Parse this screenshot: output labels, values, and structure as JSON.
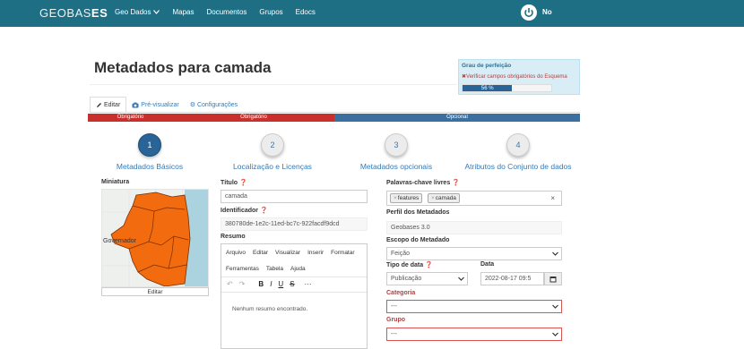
{
  "nav": {
    "brand_light": "GEOBAS",
    "brand_bold": "ES",
    "items": [
      "Geo Dados",
      "Mapas",
      "Documentos",
      "Grupos",
      "Edocs"
    ],
    "user": "No"
  },
  "page": {
    "title": "Metadados para camada"
  },
  "perfection": {
    "title": "Grau de perfeição",
    "warning": "Verificar campos obrigatórios do Esquema",
    "percent_label": "56 %",
    "percent": 56
  },
  "tabs": [
    "Editar",
    "Pré-visualizar",
    "Configurações"
  ],
  "requirement_bar": [
    "Obrigatório",
    "Obrigatório",
    "Opcional"
  ],
  "steps": [
    {
      "number": "1",
      "label": "Metadados Básicos"
    },
    {
      "number": "2",
      "label": "Localização e Licenças"
    },
    {
      "number": "3",
      "label": "Metadados opcionais"
    },
    {
      "number": "4",
      "label": "Atributos do Conjunto de dados"
    }
  ],
  "thumbnail": {
    "label": "Miniatura",
    "map_label": "Governador",
    "edit_button": "Editar"
  },
  "fields": {
    "title_label": "Título",
    "title_value": "camada",
    "identifier_label": "Identificador",
    "identifier_value": "380780de-1e2c-11ed-bc7c-922facdf9dcd",
    "summary_label": "Resumo",
    "keywords_label": "Palavras-chave livres",
    "keywords": [
      "features",
      "camada"
    ],
    "profile_label": "Perfil dos Metadados",
    "profile_value": "Geobases 3.0",
    "scope_label": "Escopo do Metadado",
    "scope_value": "Feição",
    "date_type_label": "Tipo de data",
    "date_type_value": "Publicação",
    "date_label": "Data",
    "date_value": "2022-08-17 09:5",
    "category_label": "Categoria",
    "category_value": "---",
    "group_label": "Grupo",
    "group_value": "---"
  },
  "editor": {
    "menu": [
      "Arquivo",
      "Editar",
      "Visualizar",
      "Inserir",
      "Formatar"
    ],
    "menu2": [
      "Ferramentas",
      "Tabela",
      "Ajuda"
    ],
    "tools": [
      "↶",
      "↷",
      "B",
      "I",
      "U",
      "S",
      "···"
    ],
    "empty_text": "Nenhum resumo encontrado."
  },
  "colors": {
    "navbar": "#1e6f84",
    "required": "#c9302c",
    "optional": "#3b6fa0",
    "step_active": "#2a6496"
  }
}
